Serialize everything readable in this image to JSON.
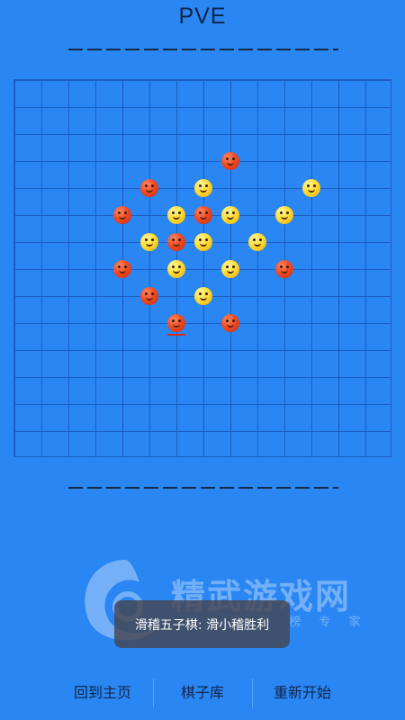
{
  "header": {
    "title": "PVE"
  },
  "board": {
    "size": 15,
    "pieces": [
      {
        "row": 3,
        "col": 8,
        "color": "red"
      },
      {
        "row": 4,
        "col": 5,
        "color": "red"
      },
      {
        "row": 4,
        "col": 7,
        "color": "yellow"
      },
      {
        "row": 4,
        "col": 11,
        "color": "yellow"
      },
      {
        "row": 5,
        "col": 4,
        "color": "red"
      },
      {
        "row": 5,
        "col": 6,
        "color": "yellow"
      },
      {
        "row": 5,
        "col": 7,
        "color": "red"
      },
      {
        "row": 5,
        "col": 8,
        "color": "yellow"
      },
      {
        "row": 5,
        "col": 10,
        "color": "yellow"
      },
      {
        "row": 6,
        "col": 5,
        "color": "yellow"
      },
      {
        "row": 6,
        "col": 6,
        "color": "red"
      },
      {
        "row": 6,
        "col": 7,
        "color": "yellow"
      },
      {
        "row": 6,
        "col": 9,
        "color": "yellow"
      },
      {
        "row": 7,
        "col": 4,
        "color": "red"
      },
      {
        "row": 7,
        "col": 6,
        "color": "yellow"
      },
      {
        "row": 7,
        "col": 8,
        "color": "yellow"
      },
      {
        "row": 7,
        "col": 10,
        "color": "red"
      },
      {
        "row": 8,
        "col": 5,
        "color": "red"
      },
      {
        "row": 8,
        "col": 7,
        "color": "yellow"
      },
      {
        "row": 9,
        "col": 6,
        "color": "red"
      },
      {
        "row": 9,
        "col": 8,
        "color": "red"
      }
    ],
    "last_move": {
      "row": 9,
      "col": 6
    }
  },
  "watermark": {
    "text": "精武游戏网",
    "subtext": "排 行 榜 专 家"
  },
  "toast": {
    "message": "滑稽五子棋: 滑小稽胜利"
  },
  "bottom_nav": {
    "home_label": "回到主页",
    "library_label": "棋子库",
    "restart_label": "重新开始"
  },
  "colors": {
    "background": "#2a86f3",
    "grid": "#1d5cc0",
    "red_piece": "#f04a22",
    "yellow_piece": "#ffdd33"
  }
}
